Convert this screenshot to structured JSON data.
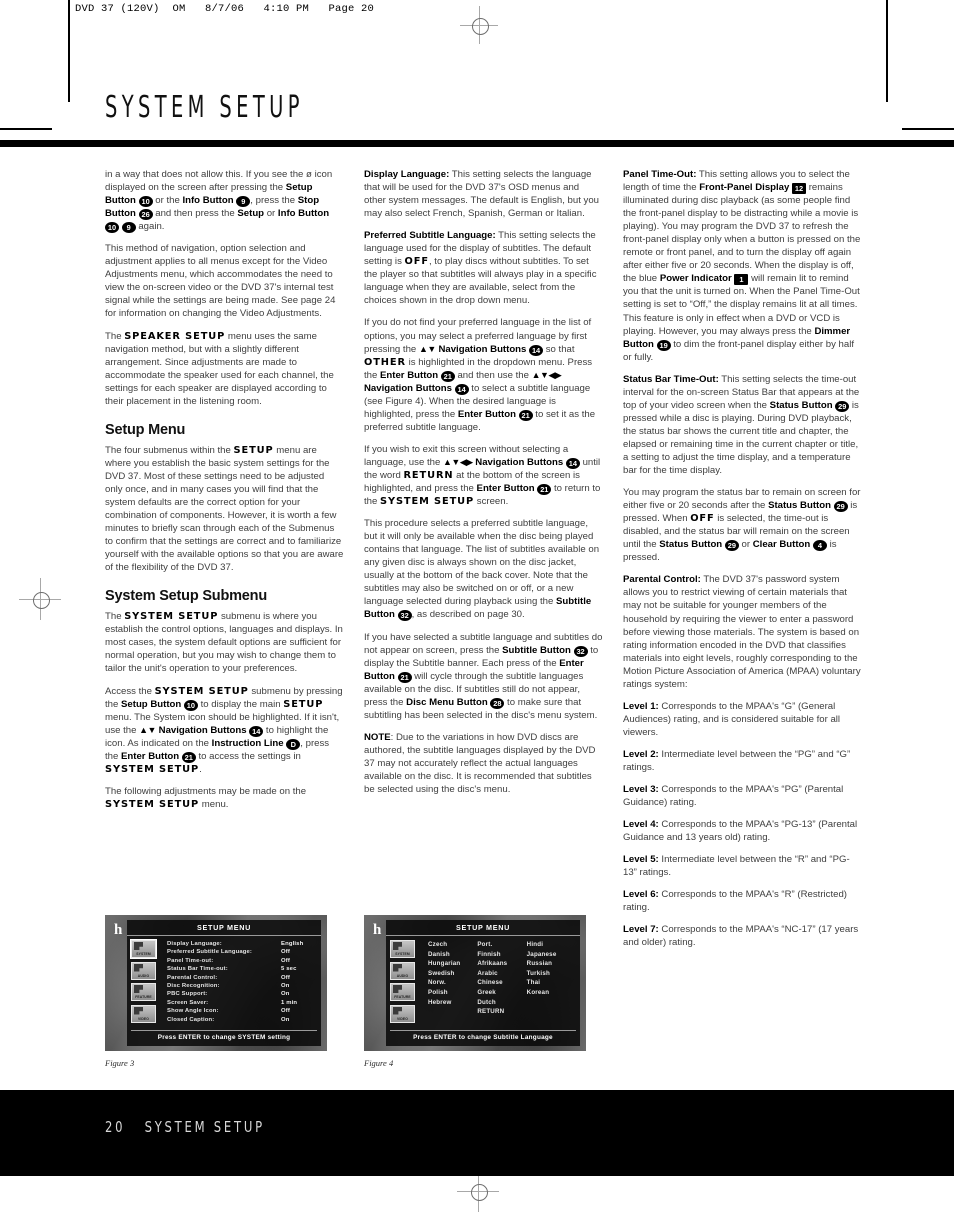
{
  "running_head": "DVD 37 (120V)  OM   8/7/06   4:10 PM   Page 20",
  "page_title": "SYSTEM SETUP",
  "footer": {
    "page_number": "20",
    "section": "SYSTEM SETUP"
  },
  "column1": {
    "p1_a": "in a way that does not allow this. If you see the ø icon displayed on the screen after pressing the ",
    "p1_setup": "Setup Button",
    "p1_b10": "10",
    "p1_b": " or the ",
    "p1_info": "Info Button",
    "p1_b9": "9",
    "p1_c": ", press the ",
    "p1_stop": "Stop Button",
    "p1_b26": "26",
    "p1_d": " and then press the ",
    "p1_setup2": "Setup",
    "p1_e": " or ",
    "p1_info2": "Info Button",
    "p1_b10b": "10",
    "p1_b9b": "9",
    "p1_f": " again.",
    "p2": "This method of navigation, option selection and adjustment applies to all menus except for the Video Adjustments menu, which accommodates the need to view the on-screen video or the DVD 37's internal test signal while the settings are being made. See page 24 for information on changing the Video Adjustments.",
    "p3_a": "The ",
    "p3_osd": "SPEAKER SETUP",
    "p3_b": " menu uses the same navigation method, but with a slightly different arrangement. Since adjustments are made to accommodate the speaker used for each channel, the settings for each speaker are displayed according to their placement in the listening room.",
    "h_setup_menu": "Setup Menu",
    "p4_a": "The four submenus within the ",
    "p4_osd": "SETUP",
    "p4_b": " menu are where you establish the basic system settings for the DVD 37. Most of these settings need to be adjusted only once, and in many cases you will find that the system defaults are the correct option for your combination of components. However, it is worth a few minutes to briefly scan through each of the Submenus to confirm that the settings are correct and to familiarize yourself with the available options so that you are aware of the flexibility of the DVD 37.",
    "h_system_setup_submenu": "System Setup Submenu",
    "p5_a": "The ",
    "p5_osd": "SYSTEM SETUP",
    "p5_b": " submenu is where you establish the control options, languages and displays. In most cases, the system default options are sufficient for normal operation, but you may wish to change them to tailor the unit's operation to your preferences.",
    "p6_a": "Access the ",
    "p6_osd1": "SYSTEM SETUP",
    "p6_b": " submenu by pressing the ",
    "p6_setup": "Setup Button",
    "p6_b10": "10",
    "p6_c": " to display the main ",
    "p6_osd2": "SETUP",
    "p6_d": " menu. The System icon should be highlighted. If it isn't, use the ",
    "p6_nav": "Navigation Buttons",
    "p6_b14": "14",
    "p6_e": " to highlight the icon. As indicated on the ",
    "p6_instr": "Instruction Line",
    "p6_bD": "D",
    "p6_f": ", press the ",
    "p6_enter": "Enter Button",
    "p6_b21": "21",
    "p6_g": " to access the settings in ",
    "p6_osd3": "SYSTEM SETUP",
    "p6_h": ".",
    "p7_a": "The following adjustments may be made on the ",
    "p7_osd": "SYSTEM SETUP",
    "p7_b": " menu."
  },
  "column2": {
    "p1_h": "Display Language:",
    "p1": " This setting selects the language that will be used for the DVD 37's OSD menus and other system messages. The default is English, but you may also select French, Spanish, German or Italian.",
    "p2_h": "Preferred Subtitle Language:",
    "p2_a": " This setting selects the language used for the display of subtitles. The default setting is ",
    "p2_osd": "OFF",
    "p2_b": ", to play discs without subtitles. To set the player so that subtitles will always play in a specific language when they are available, select from the choices shown in the drop down menu.",
    "p3_a": "If you do not find your preferred language in the list of options, you may select a preferred language by first pressing the ",
    "p3_nav": "Navigation Buttons",
    "p3_b14": "14",
    "p3_b": " so that ",
    "p3_osd": "OTHER",
    "p3_c": " is highlighted in the dropdown menu. Press the ",
    "p3_enter": "Enter Button",
    "p3_b21": "21",
    "p3_d": " and then use the ",
    "p3_nav2": "Navigation Buttons",
    "p3_b14b": "14",
    "p3_e": " to select a subtitle language (see Figure 4). When the desired language is highlighted, press the ",
    "p3_enter2": "Enter Button",
    "p3_b21b": "21",
    "p3_f": " to set it as the preferred subtitle language.",
    "p4_a": "If you wish to exit this screen without selecting a language, use the ",
    "p4_nav": "Navigation Buttons",
    "p4_b14": "14",
    "p4_b": " until the word ",
    "p4_osd1": "RETURN",
    "p4_c": " at the bottom of the screen is highlighted, and press the ",
    "p4_enter": "Enter Button",
    "p4_b21": "21",
    "p4_d": " to return to the ",
    "p4_osd2": "SYSTEM SETUP",
    "p4_e": " screen.",
    "p5_a": "This procedure selects a preferred subtitle language, but it will only be available when the disc being played contains that language. The list of subtitles available on any given disc is always shown on the disc jacket, usually at the bottom of the back cover. Note that the subtitles may also be switched on or off, or a new language selected during playback using the ",
    "p5_sub": "Subtitle Button",
    "p5_b32": "32",
    "p5_b": ", as described on page 30.",
    "p6_a": "If you have selected a subtitle language and subtitles do not appear on screen, press the ",
    "p6_sub": "Subtitle Button",
    "p6_b32": "32",
    "p6_b": " to display the Subtitle banner. Each press of the ",
    "p6_enter": "Enter Button",
    "p6_b21": "21",
    "p6_c": " will cycle through the subtitle languages available on the disc. If subtitles still do not appear, press the ",
    "p6_disc": "Disc Menu Button",
    "p6_b28": "28",
    "p6_d": " to make sure that subtitling has been selected in the disc's menu system.",
    "p7_h": "NOTE",
    "p7": ": Due to the variations in how DVD discs are authored, the subtitle languages displayed by the DVD 37 may not accurately reflect the actual languages available on the disc. It is recommended that subtitles be selected using the disc's menu."
  },
  "column3": {
    "p1_h": "Panel Time-Out:",
    "p1_a": " This setting allows you to select the length of time the ",
    "p1_fp": "Front-Panel Display",
    "p1_b12": "12",
    "p1_b": " remains illuminated during disc playback (as some people find the front-panel display to be distracting while a movie is playing). You may program the DVD 37 to refresh the front-panel display only when a button is pressed on the remote or front panel, and to turn the display off again after either five or 20 seconds. When the display is off, the blue ",
    "p1_pwr": "Power Indicator",
    "p1_b1": "1",
    "p1_c": " will remain lit to remind you that the unit is turned on. When the Panel Time-Out setting is set to “Off,” the display remains lit at all times. This feature is only in effect when a DVD or VCD is playing. However, you may always press the ",
    "p1_dim": "Dimmer Button",
    "p1_b19": "19",
    "p1_d": " to dim the front-panel display either by half or fully.",
    "p2_h": "Status Bar Time-Out:",
    "p2_a": " This setting selects the time-out interval for the on-screen Status Bar that appears at the top of your video screen when the ",
    "p2_stat": "Status Button",
    "p2_b29": "29",
    "p2_b": " is pressed while a disc is playing. During DVD playback, the status bar shows the current title and chapter, the elapsed or remaining time in the current chapter or title, a setting to adjust the time display, and a temperature bar for the time display.",
    "p3_a": "You may program the status bar to remain on screen for either five or 20 seconds after the ",
    "p3_stat": "Status Button",
    "p3_b29": "29",
    "p3_b": " is pressed. When ",
    "p3_osd": "OFF",
    "p3_c": " is selected, the time-out is disabled, and the status bar will remain on the screen until the ",
    "p3_stat2": "Status Button",
    "p3_b29b": "29",
    "p3_d": " or ",
    "p3_clear": "Clear Button",
    "p3_b4": "4",
    "p3_e": " is pressed.",
    "p4_h": "Parental Control:",
    "p4": " The DVD 37's password system allows you to restrict viewing of certain materials that may not be suitable for younger members of the household by requiring the viewer to enter a password before viewing those materials. The system is based on rating information encoded in the DVD that classifies materials into eight levels, roughly corresponding to the Motion Picture Association of America (MPAA) voluntary ratings system:",
    "levels": [
      {
        "label": "Level 1:",
        "text": " Corresponds to the MPAA's “G” (General Audiences) rating, and is considered suitable for all viewers."
      },
      {
        "label": "Level 2:",
        "text": " Intermediate level between the “PG” and “G” ratings."
      },
      {
        "label": "Level 3:",
        "text": " Corresponds to the MPAA's “PG” (Parental Guidance) rating."
      },
      {
        "label": "Level 4:",
        "text": " Corresponds to the MPAA's “PG-13” (Parental Guidance and 13 years old) rating."
      },
      {
        "label": "Level 5:",
        "text": " Intermediate level between the “R” and “PG-13” ratings."
      },
      {
        "label": "Level 6:",
        "text": " Corresponds to the MPAA's “R” (Restricted) rating."
      },
      {
        "label": "Level 7:",
        "text": " Corresponds to the MPAA's “NC-17” (17 years and older) rating."
      }
    ]
  },
  "figure3": {
    "caption": "Figure 3",
    "overlay_letter": "h",
    "title": "SETUP MENU",
    "icons": [
      {
        "name": "SYSTEM",
        "selected": true
      },
      {
        "name": "AUDIO",
        "selected": false
      },
      {
        "name": "FEATURE",
        "selected": false
      },
      {
        "name": "VIDEO",
        "selected": false
      }
    ],
    "rows": [
      {
        "label": "Display Language:",
        "value": "English"
      },
      {
        "label": "Preferred Subtitle Language:",
        "value": "Off"
      },
      {
        "label": "Panel Time-out:",
        "value": "Off"
      },
      {
        "label": "Status Bar Time-out:",
        "value": "5 sec"
      },
      {
        "label": "Parental Control:",
        "value": "Off"
      },
      {
        "label": "Disc Recognition:",
        "value": "On"
      },
      {
        "label": "PBC Support:",
        "value": "On"
      },
      {
        "label": "Screen Saver:",
        "value": "1 min"
      },
      {
        "label": "Show Angle Icon:",
        "value": "Off"
      },
      {
        "label": "Closed Caption:",
        "value": "On"
      }
    ],
    "footer": "Press ENTER to change SYSTEM setting"
  },
  "figure4": {
    "caption": "Figure 4",
    "overlay_letter": "h",
    "title": "SETUP MENU",
    "icons": [
      {
        "name": "SYSTEM",
        "selected": false
      },
      {
        "name": "AUDIO",
        "selected": false
      },
      {
        "name": "FEATURE",
        "selected": false
      },
      {
        "name": "VIDEO",
        "selected": false
      }
    ],
    "lang_col1": [
      "Czech",
      "Danish",
      "Hungarian",
      "Swedish",
      "Norw.",
      "Polish",
      "Hebrew"
    ],
    "lang_col2": [
      "Port.",
      "Finnish",
      "Afrikaans",
      "Arabic",
      "Chinese",
      "Greek",
      "Dutch",
      "RETURN"
    ],
    "lang_col3": [
      "Hindi",
      "Japanese",
      "Russian",
      "Turkish",
      "Thai",
      "Korean"
    ],
    "footer": "Press ENTER to change Subtitle Language"
  }
}
